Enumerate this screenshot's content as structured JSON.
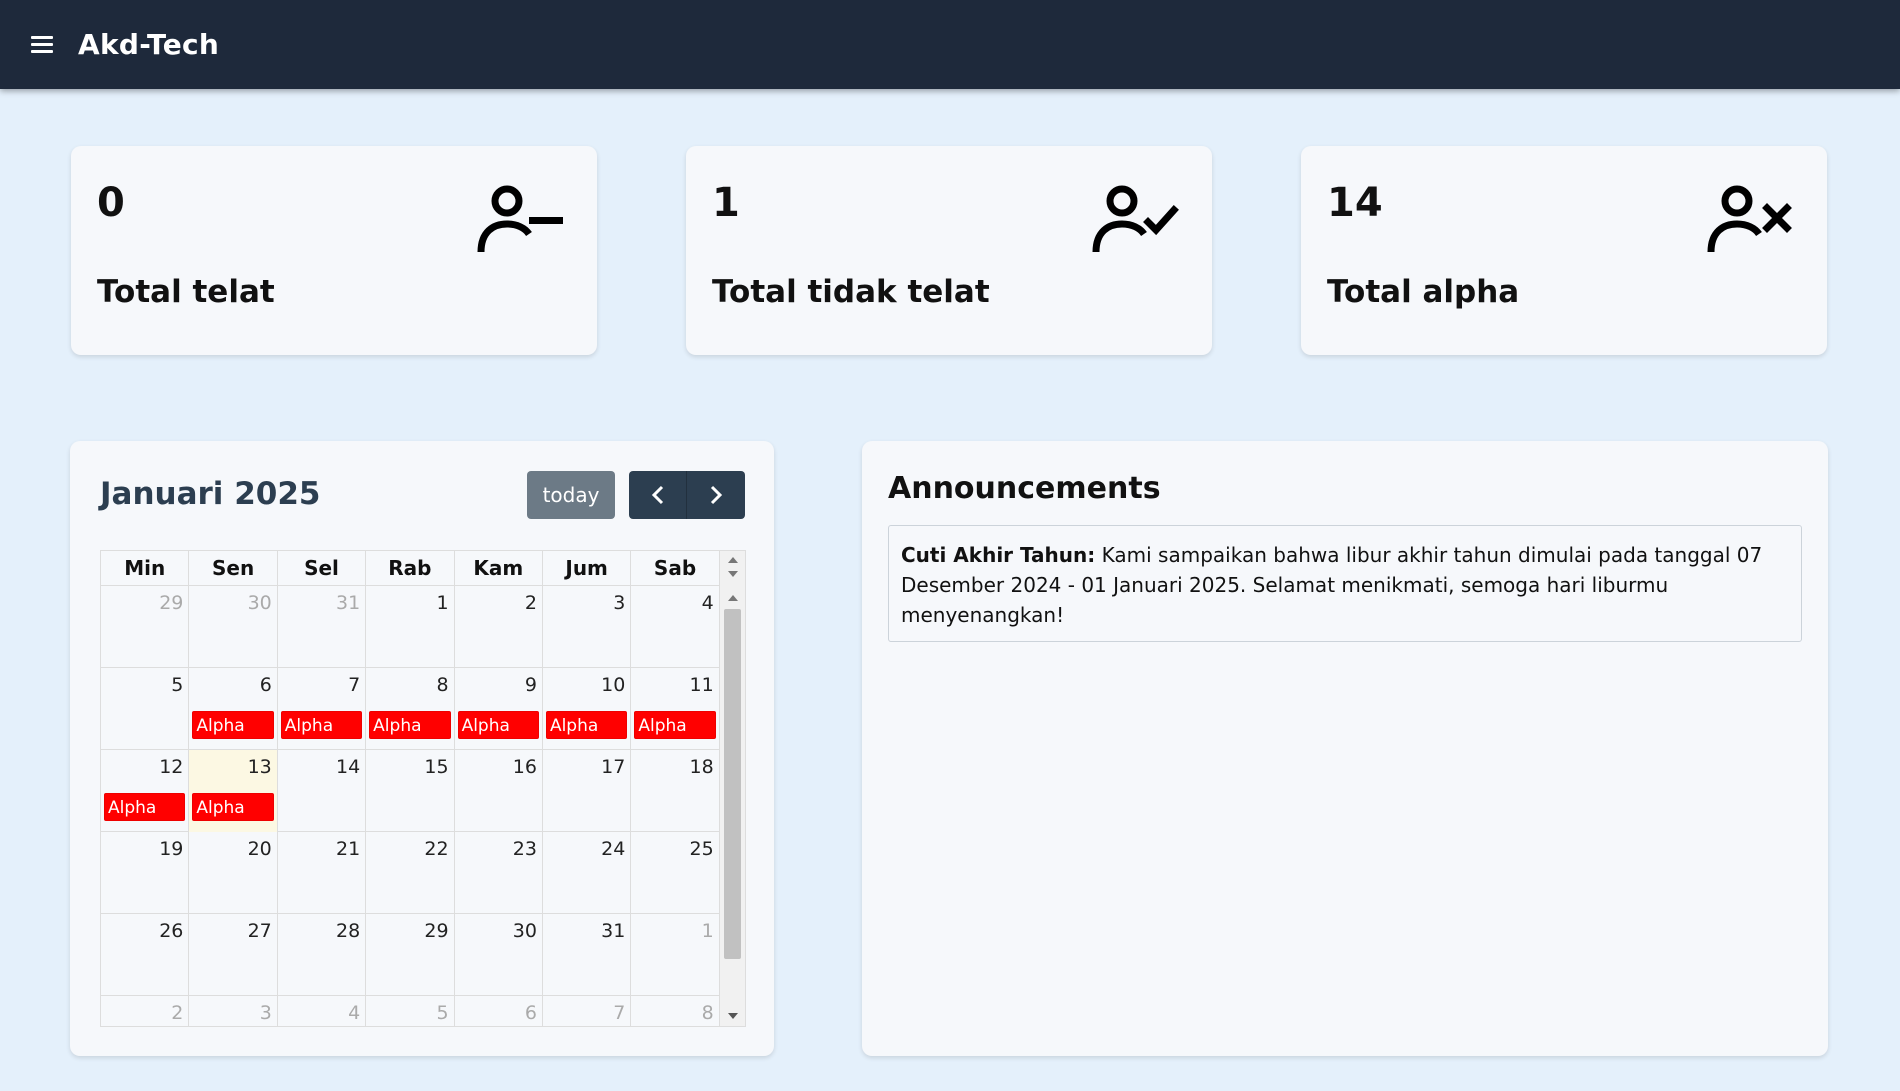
{
  "header": {
    "app_title": "Akd-Tech",
    "menu_icon": "hamburger-menu-icon"
  },
  "stats": [
    {
      "value": "0",
      "label": "Total telat",
      "icon": "user-minus-icon"
    },
    {
      "value": "1",
      "label": "Total tidak telat",
      "icon": "user-check-icon"
    },
    {
      "value": "14",
      "label": "Total alpha",
      "icon": "user-x-icon"
    }
  ],
  "calendar": {
    "title": "Januari 2025",
    "today_label": "today",
    "weekdays": [
      "Min",
      "Sen",
      "Sel",
      "Rab",
      "Kam",
      "Jum",
      "Sab"
    ],
    "weeks": [
      [
        {
          "d": "29",
          "o": true
        },
        {
          "d": "30",
          "o": true
        },
        {
          "d": "31",
          "o": true
        },
        {
          "d": "1"
        },
        {
          "d": "2"
        },
        {
          "d": "3"
        },
        {
          "d": "4"
        }
      ],
      [
        {
          "d": "5"
        },
        {
          "d": "6",
          "e": "Alpha"
        },
        {
          "d": "7",
          "e": "Alpha"
        },
        {
          "d": "8",
          "e": "Alpha"
        },
        {
          "d": "9",
          "e": "Alpha"
        },
        {
          "d": "10",
          "e": "Alpha"
        },
        {
          "d": "11",
          "e": "Alpha"
        }
      ],
      [
        {
          "d": "12",
          "e": "Alpha"
        },
        {
          "d": "13",
          "e": "Alpha",
          "t": true
        },
        {
          "d": "14"
        },
        {
          "d": "15"
        },
        {
          "d": "16"
        },
        {
          "d": "17"
        },
        {
          "d": "18"
        }
      ],
      [
        {
          "d": "19"
        },
        {
          "d": "20"
        },
        {
          "d": "21"
        },
        {
          "d": "22"
        },
        {
          "d": "23"
        },
        {
          "d": "24"
        },
        {
          "d": "25"
        }
      ],
      [
        {
          "d": "26"
        },
        {
          "d": "27"
        },
        {
          "d": "28"
        },
        {
          "d": "29"
        },
        {
          "d": "30"
        },
        {
          "d": "31"
        },
        {
          "d": "1",
          "o": true
        }
      ],
      [
        {
          "d": "2",
          "o": true
        },
        {
          "d": "3",
          "o": true
        },
        {
          "d": "4",
          "o": true
        },
        {
          "d": "5",
          "o": true
        },
        {
          "d": "6",
          "o": true
        },
        {
          "d": "7",
          "o": true
        },
        {
          "d": "8",
          "o": true
        }
      ]
    ]
  },
  "announcements": {
    "title": "Announcements",
    "items": [
      {
        "heading": "Cuti Akhir Tahun:",
        "body": "Kami sampaikan bahwa libur akhir tahun dimulai pada tanggal 07 Desember 2024 - 01 Januari 2025. Selamat menikmati, semoga hari liburmu menyenangkan!"
      }
    ]
  },
  "colors": {
    "topbar": "#1e293b",
    "background": "#e4f0fb",
    "event": "#ff0000",
    "today_cell": "#fcf8e3"
  }
}
